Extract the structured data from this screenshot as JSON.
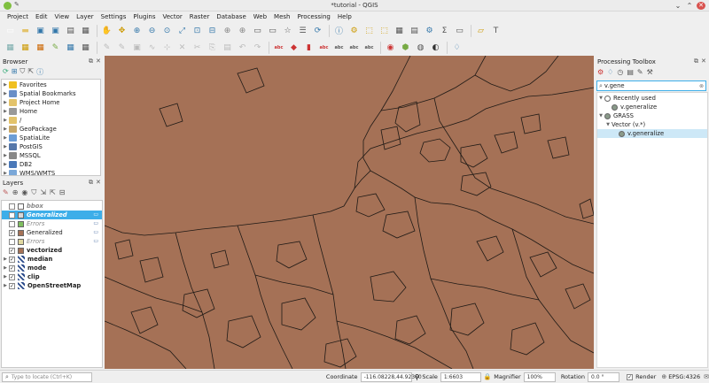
{
  "window": {
    "title": "*tutorial - QGIS"
  },
  "menu": [
    "Project",
    "Edit",
    "View",
    "Layer",
    "Settings",
    "Plugins",
    "Vector",
    "Raster",
    "Database",
    "Web",
    "Mesh",
    "Processing",
    "Help"
  ],
  "browser": {
    "title": "Browser",
    "items": [
      {
        "label": "Favorites",
        "icon": "star-icon",
        "color": "#f0c020"
      },
      {
        "label": "Spatial Bookmarks",
        "icon": "bookmark-icon",
        "color": "#6a8fc7"
      },
      {
        "label": "Project Home",
        "icon": "folder-icon",
        "color": "#e3c36b"
      },
      {
        "label": "Home",
        "icon": "home-icon",
        "color": "#999999"
      },
      {
        "label": "/",
        "icon": "folder-icon",
        "color": "#e3c36b"
      },
      {
        "label": "GeoPackage",
        "icon": "geopackage-icon",
        "color": "#c7a86a"
      },
      {
        "label": "SpatiaLite",
        "icon": "spatialite-icon",
        "color": "#6b9dd6"
      },
      {
        "label": "PostGIS",
        "icon": "postgis-icon",
        "color": "#5577aa"
      },
      {
        "label": "MSSQL",
        "icon": "mssql-icon",
        "color": "#888888"
      },
      {
        "label": "DB2",
        "icon": "db2-icon",
        "color": "#4a78b8"
      },
      {
        "label": "WMS/WMTS",
        "icon": "wms-icon",
        "color": "#7aa7d8"
      }
    ]
  },
  "layers": {
    "title": "Layers",
    "items": [
      {
        "label": "bbox",
        "checked": false,
        "color": "#ffffff",
        "italic": true,
        "bold": true,
        "greyed": true,
        "group": false
      },
      {
        "label": "Generalized",
        "checked": false,
        "color": "#d8d8d8",
        "italic": true,
        "bold": true,
        "selected": true,
        "group": false
      },
      {
        "label": "Errors",
        "checked": false,
        "color": "#7fbf5f",
        "italic": true,
        "greyed": true,
        "group": false
      },
      {
        "label": "Generalized",
        "checked": true,
        "color": "#a57156",
        "italic": false,
        "bold": false,
        "group": false
      },
      {
        "label": "Errors",
        "checked": false,
        "color": "#e0d8a0",
        "italic": true,
        "greyed": true,
        "group": false
      },
      {
        "label": "vectorized",
        "checked": true,
        "color": "#a57156",
        "bold": true,
        "group": false
      },
      {
        "label": "median",
        "checked": true,
        "bold": true,
        "group": true
      },
      {
        "label": "mode",
        "checked": true,
        "bold": true,
        "group": true
      },
      {
        "label": "clip",
        "checked": true,
        "bold": true,
        "group": true
      },
      {
        "label": "OpenStreetMap",
        "checked": true,
        "bold": true,
        "group": true
      }
    ]
  },
  "processing": {
    "title": "Processing Toolbox",
    "search_value": "v.gene",
    "tree": [
      {
        "label": "Recently used",
        "depth": 0,
        "expanded": true,
        "icon": "clock-icon"
      },
      {
        "label": "v.generalize",
        "depth": 1,
        "icon": "grass-icon"
      },
      {
        "label": "GRASS",
        "depth": 0,
        "expanded": true,
        "icon": "grass-icon"
      },
      {
        "label": "Vector (v.*)",
        "depth": 1,
        "expanded": true,
        "icon": ""
      },
      {
        "label": "v.generalize",
        "depth": 2,
        "icon": "grass-icon",
        "selected": true
      }
    ]
  },
  "status": {
    "locate_placeholder": "Type to locate (Ctrl+K)",
    "coordinate_label": "Coordinate",
    "coordinate_value": "-116.08228,44.92360",
    "scale_label": "Scale",
    "scale_value": "1:6603",
    "magnifier_label": "Magnifier",
    "magnifier_value": "100%",
    "rotation_label": "Rotation",
    "rotation_value": "0.0 °",
    "render_label": "Render",
    "crs_label": "EPSG:4326"
  },
  "colors": {
    "map_fill": "#a57156",
    "selection": "#3daee9",
    "polygon_stroke": "#1f1a16"
  }
}
